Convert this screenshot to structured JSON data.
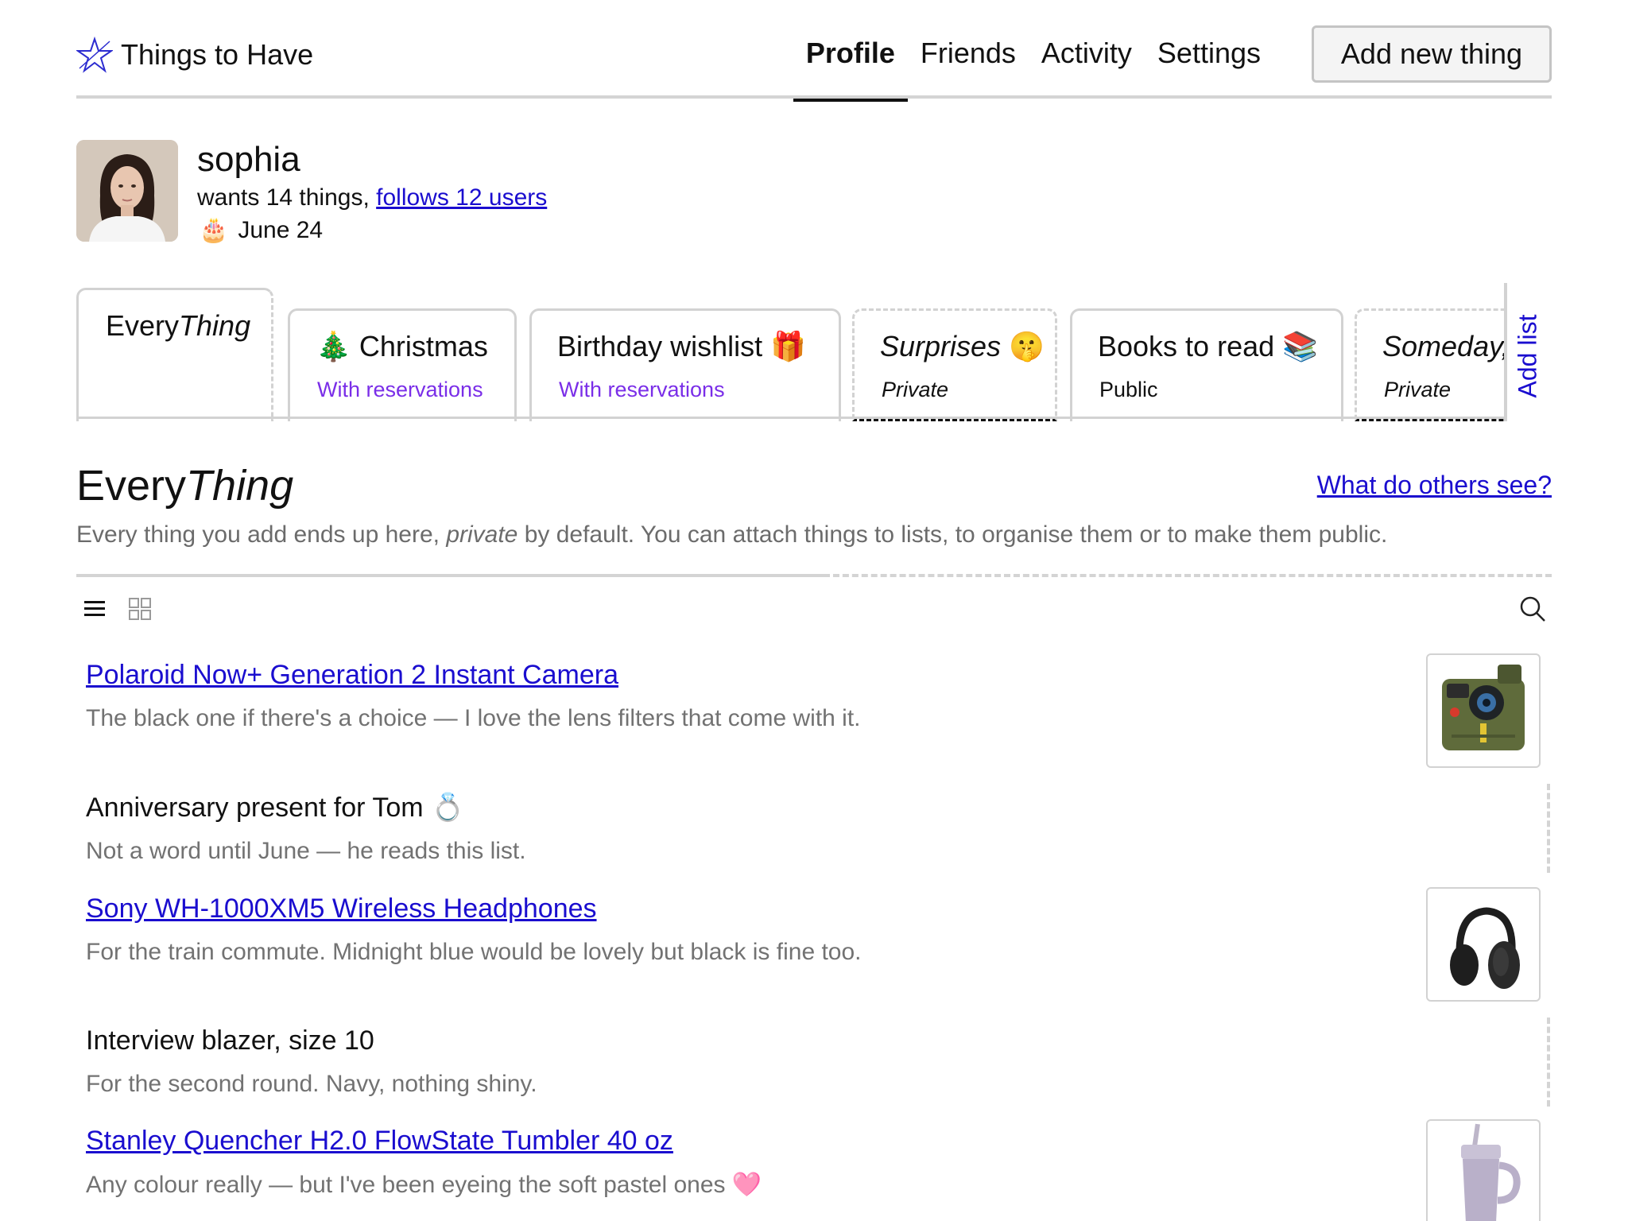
{
  "app": {
    "name": "Things to Have",
    "logo_icon": "star-outline-icon"
  },
  "nav": {
    "items": [
      {
        "label": "Profile",
        "active": true
      },
      {
        "label": "Friends",
        "active": false
      },
      {
        "label": "Activity",
        "active": false
      },
      {
        "label": "Settings",
        "active": false
      }
    ],
    "add_button": "Add new thing"
  },
  "profile": {
    "name": "sophia",
    "wants_text": "wants 14 things, ",
    "follows_text": "follows 12 users",
    "birthday_icon": "🎂",
    "birthday": "June 24"
  },
  "lists": {
    "tabs": [
      {
        "title_a": "Every",
        "title_b": "Thing",
        "subtitle": "",
        "active": true
      },
      {
        "title": "Christmas",
        "emoji": "🎄",
        "subtitle": "With reservations"
      },
      {
        "title": "Birthday wishlist",
        "emoji": "🎁",
        "subtitle": "With reservations"
      },
      {
        "title": "Surprises",
        "emoji": "🤫",
        "subtitle": "Private"
      },
      {
        "title": "Books to read",
        "emoji": "📚",
        "subtitle": "Public"
      },
      {
        "title": "Someday, m",
        "emoji": "",
        "subtitle": "Private"
      }
    ],
    "add_list": "Add list"
  },
  "section": {
    "title_a": "Every",
    "title_b": "Thing",
    "others_link": "What do others see?",
    "desc_a": "Every thing you add ends up here, ",
    "desc_em": "private",
    "desc_b": " by default. You can attach things to lists, to organise them or to make them public."
  },
  "toolbar": {
    "list_view_icon": "list-view-icon",
    "grid_view_icon": "grid-view-icon",
    "search_icon": "search-icon"
  },
  "items": [
    {
      "title": "Polaroid Now+ Generation 2 Instant Camera",
      "link": true,
      "note": "The black one if there's a choice — I love the lens filters that come with it."
    },
    {
      "title": "Anniversary present for Tom 💍",
      "link": false,
      "note": "Not a word until June — he reads this list."
    },
    {
      "title": "Sony WH-1000XM5 Wireless Headphones",
      "link": true,
      "note": "For the train commute. Midnight blue would be lovely but black is fine too."
    },
    {
      "title": "Interview blazer, size 10",
      "link": false,
      "note": "For the second round. Navy, nothing shiny."
    },
    {
      "title": "Stanley Quencher H2.0 FlowState Tumbler 40 oz",
      "link": true,
      "note": "Any colour really — but I've been eyeing the soft pastel ones 🩷"
    }
  ],
  "colors": {
    "link": "#1a0dcf",
    "reservation": "#7a2ee8",
    "muted": "#727272",
    "border": "#d2d2d2"
  }
}
